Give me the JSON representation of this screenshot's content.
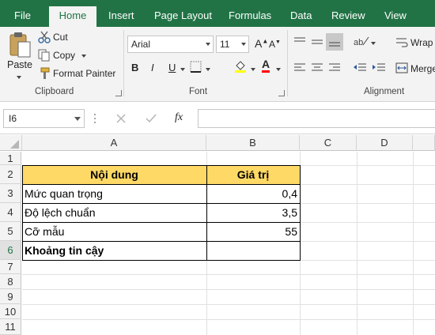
{
  "ribbon_tabs": [
    "File",
    "Home",
    "Insert",
    "Page Layout",
    "Formulas",
    "Data",
    "Review",
    "View"
  ],
  "active_tab": "Home",
  "clipboard": {
    "paste": "Paste",
    "cut": "Cut",
    "copy": "Copy",
    "format_painter": "Format Painter",
    "group_label": "Clipboard"
  },
  "font": {
    "font_name": "Arial",
    "font_size": "11",
    "bold": "B",
    "italic": "I",
    "underline": "U",
    "group_label": "Font",
    "font_color_letter": "A",
    "grow_letter": "A",
    "shrink_letter": "A"
  },
  "alignment": {
    "wrap": "Wrap T",
    "merge": "Merge",
    "group_label": "Alignment"
  },
  "formula_bar": {
    "name_box": "I6",
    "fx": "fx",
    "formula": ""
  },
  "columns": [
    "A",
    "B",
    "C",
    "D"
  ],
  "rows": [
    "1",
    "2",
    "3",
    "4",
    "5",
    "6",
    "7",
    "8",
    "9",
    "10",
    "11"
  ],
  "selected_row": "6",
  "table": {
    "header_a": "Nội dung",
    "header_b": "Giá trị",
    "r3_a": "Mức quan trọng",
    "r3_b": "0,4",
    "r4_a": "Độ lệch chuẩn",
    "r4_b": "3,5",
    "r5_a": "Cỡ mẫu",
    "r5_b": "55",
    "r6_a": "Khoảng tin cậy",
    "r6_b": ""
  },
  "colors": {
    "accent": "#217346",
    "header_fill": "#ffd966"
  }
}
